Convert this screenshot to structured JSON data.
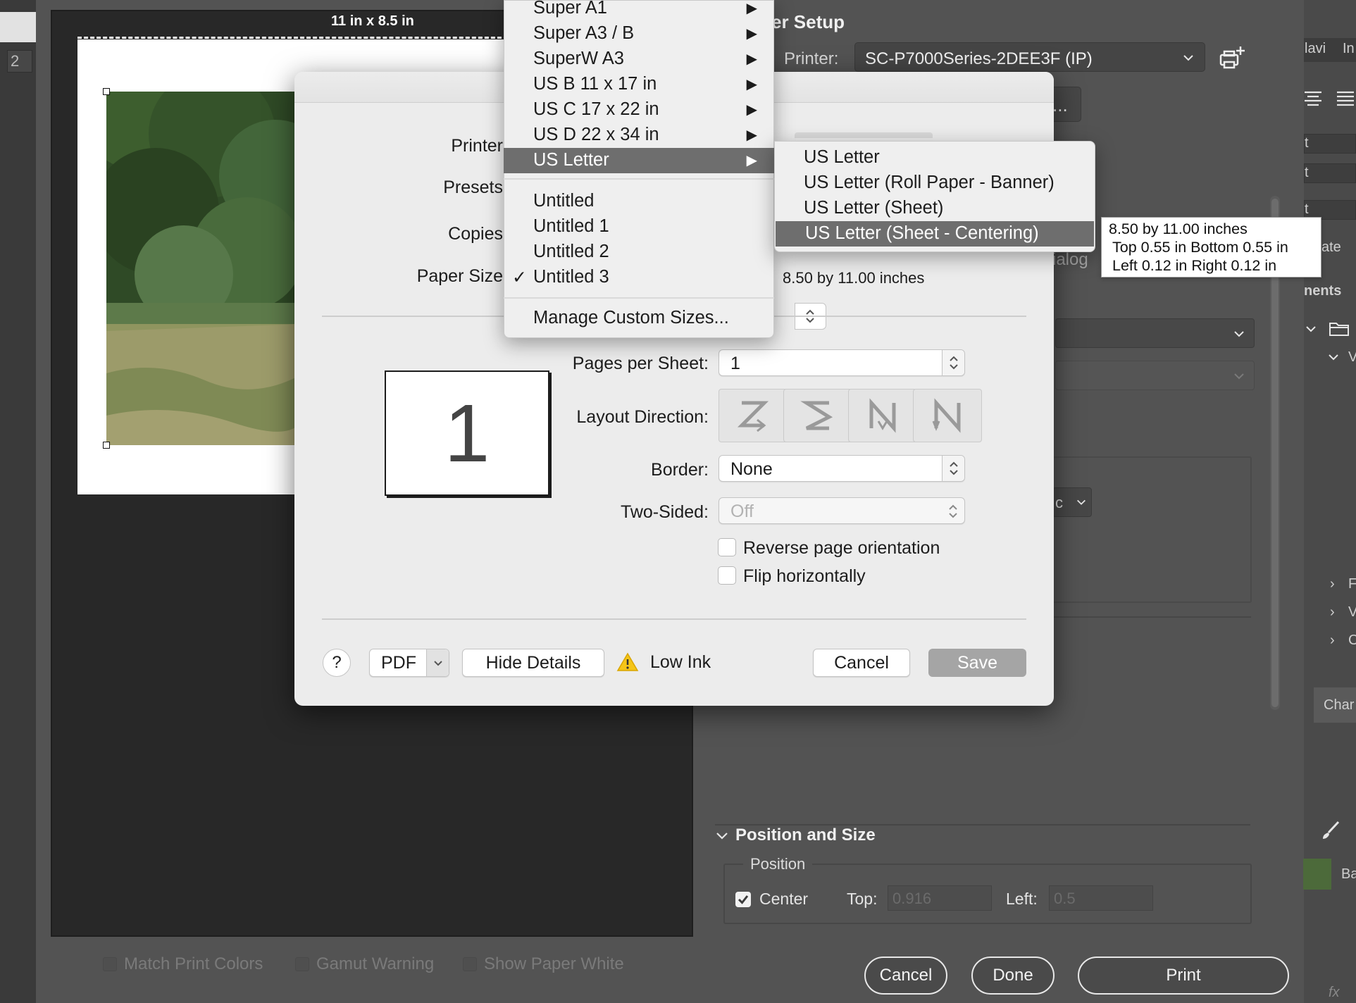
{
  "background": {
    "preview_paper_size": "11 in x 8.5 in",
    "page_number": "2",
    "checkboxes": [
      "Match Print Colors",
      "Gamut Warning",
      "Show Paper White"
    ],
    "settings_title": "er Setup",
    "printer_label": "Printer:",
    "printer_value": "SC-P7000Series-2DEE3F (IP)",
    "dots_button": "...",
    "dialog_text": "ialog",
    "c_select": "c",
    "position_size": {
      "title": "Position and Size",
      "legend": "Position",
      "center_label": "Center",
      "center_checked": true,
      "top_label": "Top:",
      "top_value": "0.916",
      "left_label": "Left:",
      "left_value": "0.5"
    },
    "buttons": {
      "cancel": "Cancel",
      "done": "Done",
      "print": "Print"
    },
    "right_strip": {
      "tabs": [
        "lavi",
        "In"
      ],
      "fields": [
        "t",
        "t",
        "t"
      ],
      "ate": "ate",
      "ents": "nents",
      "tree_items": [
        "V",
        "F",
        "V",
        "C"
      ],
      "char_tab": "Char",
      "layer_name": "Ba",
      "fx": "fx"
    }
  },
  "print_dialog": {
    "labels": {
      "printer": "Printer",
      "presets": "Presets",
      "copies": "Copies",
      "paper_size": "Paper Size",
      "pages_per_sheet": "Pages per Sheet:",
      "layout_direction": "Layout Direction:",
      "border": "Border:",
      "two_sided": "Two-Sided:"
    },
    "paper_dimensions": "8.50 by 11.00 inches",
    "page_thumbnail": "1",
    "pages_per_sheet_value": "1",
    "border_value": "None",
    "two_sided_value": "Off",
    "reverse_orientation": "Reverse page orientation",
    "flip_horizontally": "Flip horizontally",
    "help": "?",
    "pdf": "PDF",
    "hide_details": "Hide Details",
    "low_ink": "Low Ink",
    "cancel": "Cancel",
    "save": "Save"
  },
  "paper_menu": {
    "items": [
      {
        "label": "Super A1",
        "submenu": true
      },
      {
        "label": "Super A3 / B",
        "submenu": true
      },
      {
        "label": "SuperW A3",
        "submenu": true
      },
      {
        "label": "US B 11 x 17 in",
        "submenu": true
      },
      {
        "label": "US C 17 x 22 in",
        "submenu": true
      },
      {
        "label": "US D 22 x 34 in",
        "submenu": true
      },
      {
        "label": "US Letter",
        "submenu": true,
        "selected": true
      }
    ],
    "custom_items": [
      {
        "label": "Untitled"
      },
      {
        "label": "Untitled 1"
      },
      {
        "label": "Untitled 2"
      },
      {
        "label": "Untitled 3",
        "checked": true
      }
    ],
    "manage": "Manage Custom Sizes...",
    "arrow_glyph": "▶",
    "check_glyph": "✓"
  },
  "paper_submenu": {
    "items": [
      {
        "label": "US Letter"
      },
      {
        "label": "US Letter (Roll Paper - Banner)"
      },
      {
        "label": "US Letter (Sheet)"
      },
      {
        "label": "US Letter (Sheet - Centering)",
        "selected": true
      }
    ]
  },
  "tooltip": {
    "line1": "8.50 by 11.00 inches",
    "line2": "Top 0.55 in Bottom 0.55 in",
    "line3": "Left 0.12 in Right 0.12 in"
  },
  "colors": {
    "menu_highlight": "#6e6e6e",
    "dialog_bg": "#ececec",
    "ps_bg": "#535353",
    "warning": "#f5c518"
  },
  "icons": [
    "printer-settings-icon",
    "chevron-down-icon",
    "warning-icon",
    "folder-icon",
    "brush-icon",
    "align-center-icon",
    "align-justify-icon"
  ]
}
